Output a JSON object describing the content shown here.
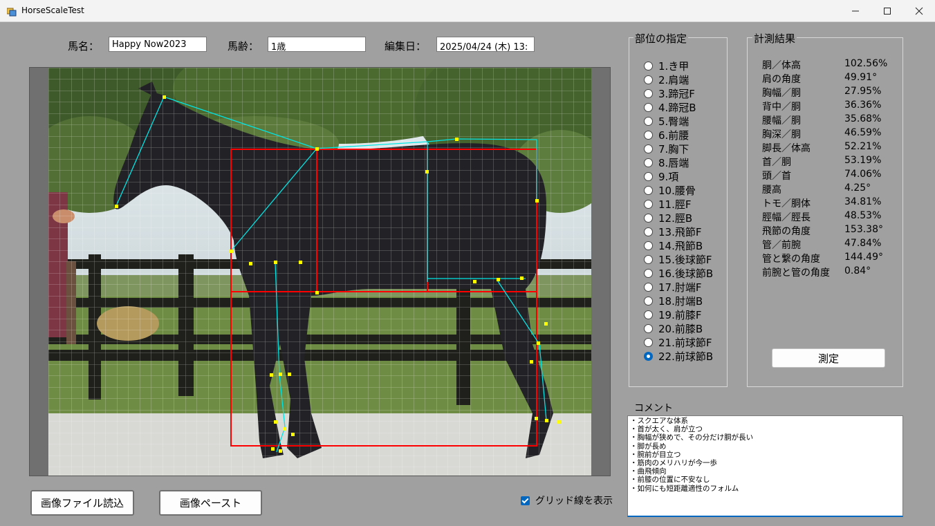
{
  "window": {
    "title": "HorseScaleTest",
    "minimize_icon": "minimize-icon",
    "maximize_icon": "maximize-icon",
    "close_icon": "close-icon"
  },
  "form": {
    "name_label": "馬名：",
    "name_value": "Happy Now2023",
    "age_label": "馬齢：",
    "age_value": "1歳",
    "date_label": "編集日：",
    "date_value": "2025/04/24 (木) 13:"
  },
  "buttons": {
    "load_image": "画像ファイル読込",
    "paste_image": "画像ペースト",
    "measure": "測定"
  },
  "grid_option": {
    "label": "グリッド線を表示",
    "checked": true
  },
  "parts": {
    "title": "部位の指定",
    "items": [
      "1.き甲",
      "2.肩端",
      "3.蹄冠F",
      "4.蹄冠B",
      "5.臀端",
      "6.前腰",
      "7.胸下",
      "8.唇端",
      "9.項",
      "10.腰骨",
      "11.脛F",
      "12.脛B",
      "13.飛節F",
      "14.飛節B",
      "15.後球節F",
      "16.後球節B",
      "17.肘端F",
      "18.肘端B",
      "19.前膝F",
      "20.前膝B",
      "21.前球節F",
      "22.前球節B"
    ],
    "selected_index": 21
  },
  "results": {
    "title": "計測結果",
    "rows": [
      {
        "name": "胴／体高",
        "value": "102.56%"
      },
      {
        "name": "肩の角度",
        "value": "49.91°"
      },
      {
        "name": "胸幅／胴",
        "value": "27.95%"
      },
      {
        "name": "背中／胴",
        "value": "36.36%"
      },
      {
        "name": "腰幅／胴",
        "value": "35.68%"
      },
      {
        "name": "胸深／胴",
        "value": "46.59%"
      },
      {
        "name": "脚長／体高",
        "value": "52.21%"
      },
      {
        "name": "首／胴",
        "value": "53.19%"
      },
      {
        "name": "頭／首",
        "value": "74.06%"
      },
      {
        "name": "腰高",
        "value": "4.25°"
      },
      {
        "name": "トモ／胴体",
        "value": "34.81%"
      },
      {
        "name": "脛幅／脛長",
        "value": "48.53%"
      },
      {
        "name": "飛節の角度",
        "value": "153.38°"
      },
      {
        "name": "管／前腕",
        "value": "47.84%"
      },
      {
        "name": "管と繋の角度",
        "value": "144.49°"
      },
      {
        "name": "前腕と管の角度",
        "value": "0.84°"
      }
    ]
  },
  "comment": {
    "label": "コメント",
    "lines": [
      "・スクエアな体系",
      "・首が太く、肩が立つ",
      "・胸幅が狭めで、その分だけ胴が長い",
      "・脚が長め",
      "・腕前が目立つ",
      "・筋肉のメリハリが今一歩",
      "・曲飛傾向",
      "・前膝の位置に不安なし",
      "・如何にも短距離適性のフォルム"
    ]
  },
  "colors": {
    "background": "#a0a0a0",
    "accent": "#0067c0",
    "marker": "#ffff00",
    "skeleton_line": "#00e5e5",
    "frame_line": "#ff0000"
  }
}
